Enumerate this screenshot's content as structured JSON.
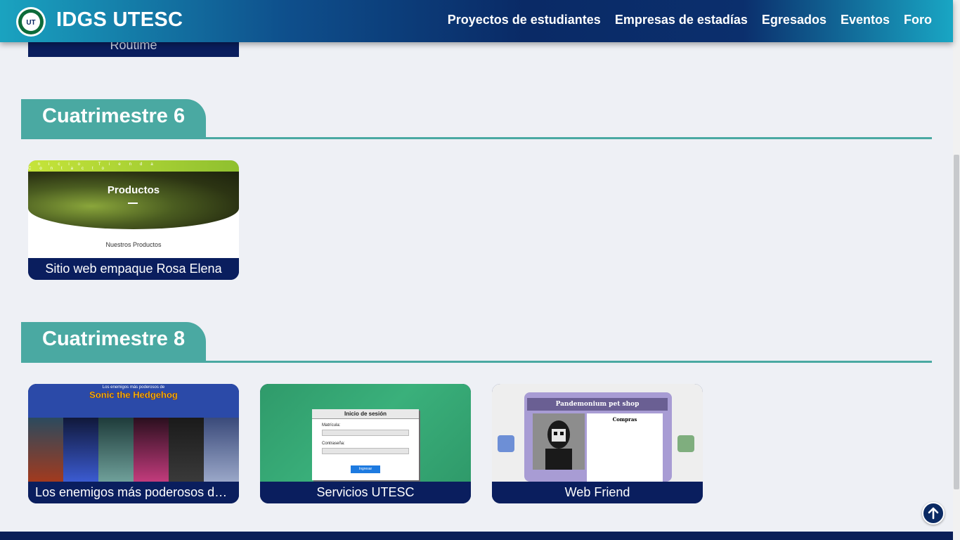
{
  "header": {
    "title": "IDGS UTESC",
    "logo_text": "UTESC",
    "nav": [
      {
        "label": "Proyectos de estudiantes"
      },
      {
        "label": "Empresas de estadías"
      },
      {
        "label": "Egresados"
      },
      {
        "label": "Eventos"
      },
      {
        "label": "Foro"
      }
    ]
  },
  "partial_card": {
    "caption": "Routime"
  },
  "sections": [
    {
      "title": "Cuatrimestre 6",
      "cards": [
        {
          "caption": "Sitio web empaque Rosa Elena",
          "thumb": {
            "hero_title": "Productos",
            "subtitle": "Nuestros Productos",
            "nav": "Inicio Tienda Contacto"
          }
        }
      ]
    },
    {
      "title": "Cuatrimestre 8",
      "cards": [
        {
          "caption": "Los enemigos más poderosos de ...",
          "thumb": {
            "header": "Los enemigos más poderosos de",
            "game_title": "Sonic the Hedgehog"
          }
        },
        {
          "caption": "Servicios UTESC",
          "thumb": {
            "title": "Inicio de sesión",
            "field1": "Matrícula:",
            "field2": "Contraseña:",
            "button": "Ingresar"
          }
        },
        {
          "caption": "Web Friend",
          "thumb": {
            "title": "Pandemonium pet shop",
            "list_title": "Compras"
          }
        }
      ]
    }
  ],
  "colors": {
    "accent": "#4aa9a2",
    "caption_bg": "#0a1e5e",
    "page_bg": "#eef0f5"
  }
}
